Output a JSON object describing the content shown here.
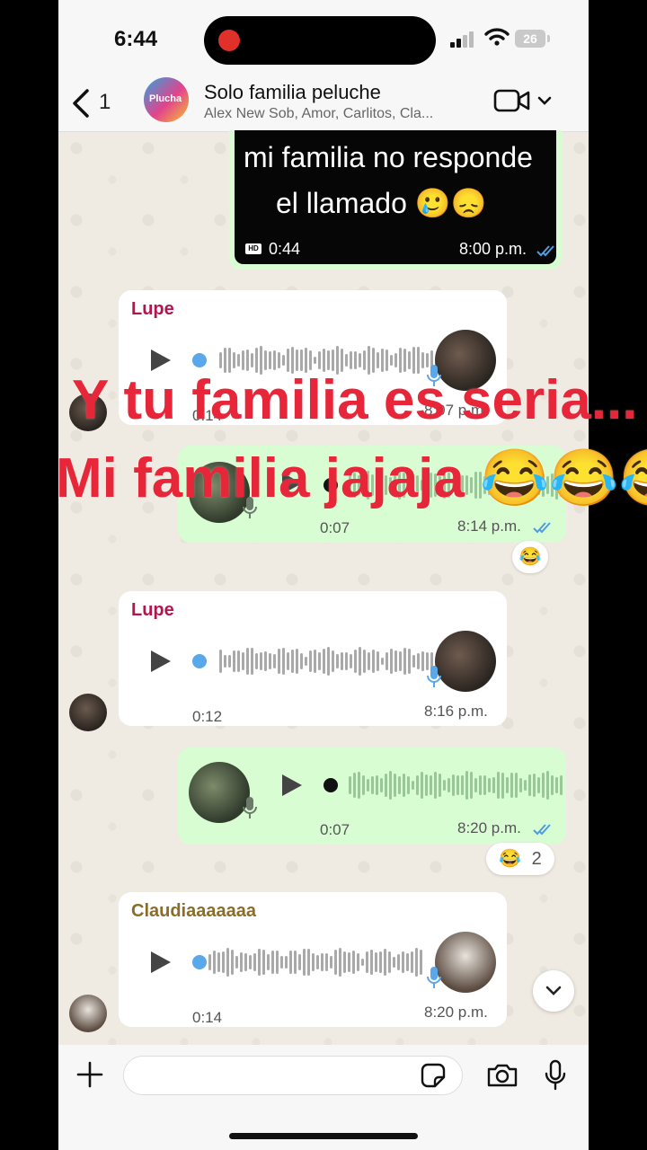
{
  "status_bar": {
    "time": "6:44",
    "battery": "26"
  },
  "header": {
    "back_count": "1",
    "group_name": "Solo familia peluche",
    "group_avatar_text": "Plucha",
    "members": "Alex New Sob, Amor, Carlitos, Cla..."
  },
  "video_message": {
    "line1": "mi familia no responde",
    "line2": "el llamado 🥲😞",
    "hd_label": "HD",
    "duration": "0:44",
    "time": "8:00 p.m."
  },
  "messages": [
    {
      "sender": "Lupe",
      "duration": "0:14",
      "time": "8:07 p.m."
    },
    {
      "duration": "0:07",
      "time": "8:14 p.m.",
      "reaction": "😂"
    },
    {
      "sender": "Lupe",
      "duration": "0:12",
      "time": "8:16 p.m."
    },
    {
      "duration": "0:07",
      "time": "8:20 p.m.",
      "reaction": "😂",
      "reaction_count": "2"
    },
    {
      "sender": "Claudiaaaaaaa",
      "duration": "0:14",
      "time": "8:20 p.m."
    }
  ],
  "overlay": {
    "line1": "Y tu familia es seria...",
    "line2": "Mi familia jajaja 😂😂😂"
  },
  "colors": {
    "sender_lupe": "#b1164e",
    "sender_claudia": "#8a6d2b",
    "overlay": "#e8263a",
    "outgoing": "#d9fdd3",
    "tick": "#4f9dde"
  }
}
